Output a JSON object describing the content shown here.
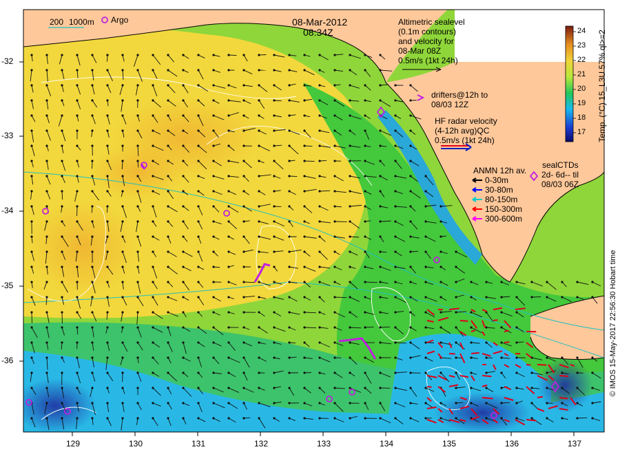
{
  "header": {
    "date": "08-Mar-2012",
    "time": "08:34Z"
  },
  "scale_legend": {
    "depth_200": "200",
    "depth_1000": "1000m",
    "argo": "Argo"
  },
  "altimetry_note": [
    "Altimetric sealevel",
    "(0.1m contours)",
    "and velocity for",
    "08-Mar 08Z",
    "0.5m/s (1kt 24h)"
  ],
  "drifters_note": [
    "drifters@12h to",
    "08/03 12Z"
  ],
  "hf_radar_note": [
    "HF radar velocity",
    "(4-12h avg)QC",
    "0.5m/s (1kt 24h)"
  ],
  "anmn": {
    "title": "ANMN 12h av.",
    "items": [
      {
        "label": "0-30m",
        "color": "#000000"
      },
      {
        "label": "30-80m",
        "color": "#0000ff"
      },
      {
        "label": "80-150m",
        "color": "#00cccc"
      },
      {
        "label": "150-300m",
        "color": "#ff0000"
      },
      {
        "label": "300-600m",
        "color": "#ff00ff"
      }
    ]
  },
  "seal_ctds": [
    "sealCTDs",
    "2d- 6d-- til",
    "08/03 06Z"
  ],
  "colorbar": {
    "title": "Temp. (°C) 15_L3U 57% ql>=2",
    "ticks": [
      "24",
      "23",
      "22",
      "21",
      "20",
      "19",
      "18",
      "17"
    ],
    "min": 16.5,
    "max": 24.5
  },
  "credit": "© IMOS 15-May-2017 22:56:30 Hobart time",
  "axes": {
    "x_ticks": [
      "129",
      "130",
      "131",
      "132",
      "133",
      "134",
      "135",
      "136",
      "137"
    ],
    "y_ticks": [
      "-32",
      "-33",
      "-34",
      "-35",
      "-36"
    ]
  },
  "colors": {
    "land": "#ffc89a",
    "warm": "#f6c23a",
    "mid": "#c8e83a",
    "green": "#39c43a",
    "cool": "#27b7e8",
    "cold": "#1d3aa8",
    "radar": "#e0001a",
    "drifter": "#c020e0",
    "contour": "#ffffff"
  }
}
